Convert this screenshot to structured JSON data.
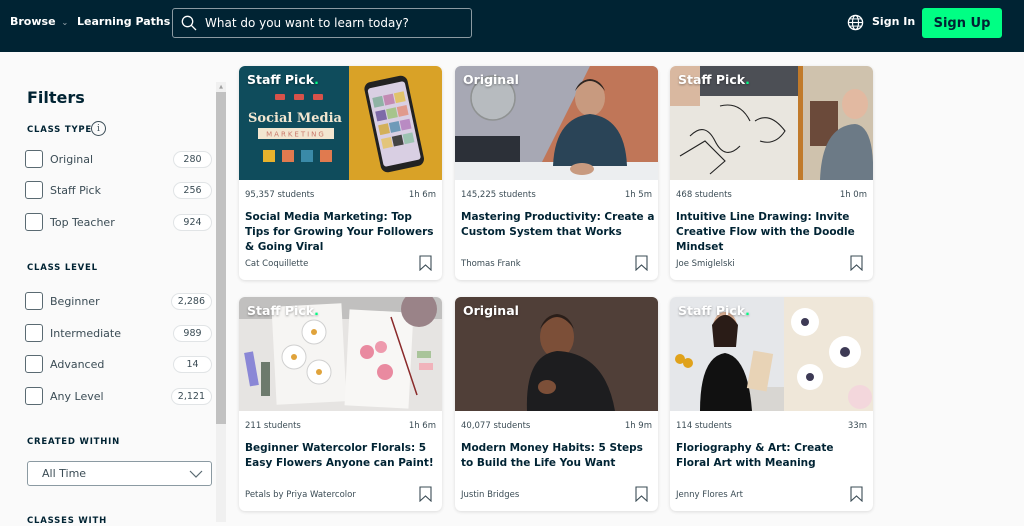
{
  "nav": {
    "browse_label": "Browse",
    "learning_paths_label": "Learning Paths",
    "search_placeholder": "What do you want to learn today?",
    "sign_in_label": "Sign In",
    "sign_up_label": "Sign Up",
    "colors": {
      "nav_bg": "#002333",
      "accent": "#00ff84"
    }
  },
  "sidebar": {
    "title": "Filters",
    "class_type": {
      "label": "CLASS TYPE",
      "options": [
        {
          "label": "Original",
          "count": "280",
          "checked": false
        },
        {
          "label": "Staff Pick",
          "count": "256",
          "checked": false
        },
        {
          "label": "Top Teacher",
          "count": "924",
          "checked": false
        }
      ]
    },
    "class_level": {
      "label": "CLASS LEVEL",
      "options": [
        {
          "label": "Beginner",
          "count": "2,286",
          "checked": false
        },
        {
          "label": "Intermediate",
          "count": "989",
          "checked": false
        },
        {
          "label": "Advanced",
          "count": "14",
          "checked": false
        },
        {
          "label": "Any Level",
          "count": "2,121",
          "checked": false
        }
      ]
    },
    "created_within": {
      "label": "CREATED WITHIN",
      "selected": "All Time"
    },
    "classes_with": {
      "label": "CLASSES WITH"
    }
  },
  "classes": [
    {
      "badge": "Staff Pick",
      "badge_dot": ".",
      "students": "95,357 students",
      "duration": "1h 6m",
      "title": "Social Media Marketing: Top Tips for Growing Your Followers & Going Viral",
      "teacher": "Cat Coquillette",
      "thumb_text": "Social Media",
      "thumb_sub": "MARKETING"
    },
    {
      "badge": "Original",
      "badge_dot": "",
      "students": "145,225 students",
      "duration": "1h 5m",
      "title": "Mastering Productivity: Create a Custom System that Works",
      "teacher": "Thomas Frank"
    },
    {
      "badge": "Staff Pick",
      "badge_dot": ".",
      "students": "468 students",
      "duration": "1h 0m",
      "title": "Intuitive Line Drawing: Invite Creative Flow with the Doodle Mindset",
      "teacher": "Joe Smiglelski"
    },
    {
      "badge": "Staff Pick",
      "badge_dot": ".",
      "students": "211 students",
      "duration": "1h 6m",
      "title": "Beginner Watercolor Florals: 5 Easy Flowers Anyone can Paint!",
      "teacher": "Petals by Priya Watercolor"
    },
    {
      "badge": "Original",
      "badge_dot": "",
      "students": "40,077 students",
      "duration": "1h 9m",
      "title": "Modern Money Habits: 5 Steps to Build the Life You Want",
      "teacher": "Justin Bridges"
    },
    {
      "badge": "Staff Pick",
      "badge_dot": ".",
      "students": "114 students",
      "duration": "33m",
      "title": "Floriography & Art: Create Floral Art with Meaning",
      "teacher": "Jenny Flores Art"
    }
  ]
}
